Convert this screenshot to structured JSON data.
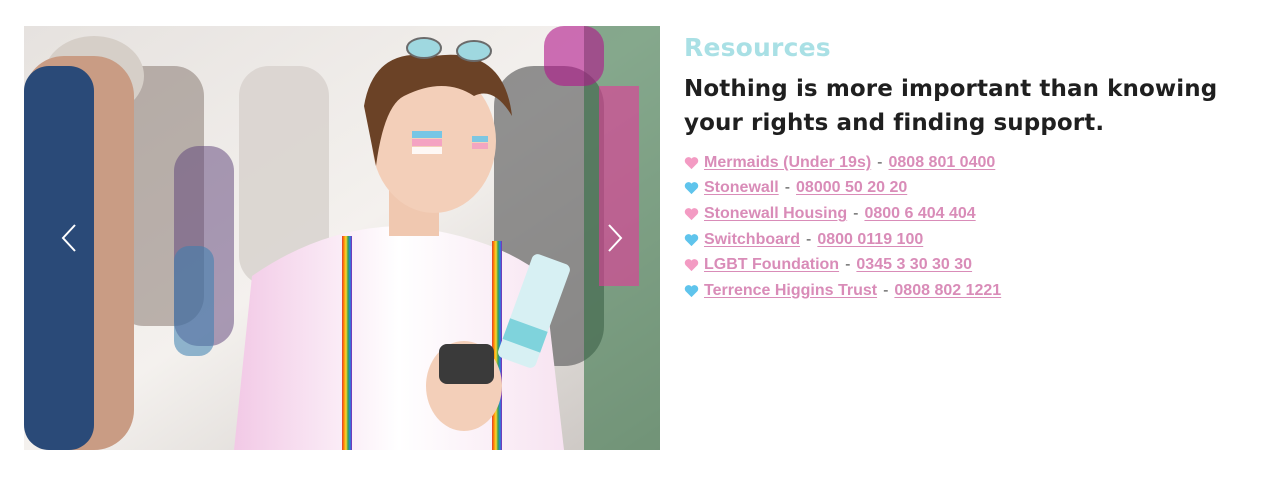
{
  "carousel": {
    "prev_icon": "chevron-left-icon",
    "next_icon": "chevron-right-icon"
  },
  "resources": {
    "section_label": "Resources",
    "headline": "Nothing is more important than knowing your rights and finding support.",
    "separator": "-",
    "items": [
      {
        "name": "Mermaids (Under 19s)",
        "phone": "0808 801 0400",
        "heart": "pink-heart-icon",
        "heart_color": "#f39bc3"
      },
      {
        "name": "Stonewall",
        "phone": "08000 50 20 20",
        "heart": "blue-heart-icon",
        "heart_color": "#5fc4ec"
      },
      {
        "name": "Stonewall Housing",
        "phone": "0800 6 404 404",
        "heart": "pink-heart-icon",
        "heart_color": "#f39bc3"
      },
      {
        "name": "Switchboard",
        "phone": "0800 0119 100",
        "heart": "blue-heart-icon",
        "heart_color": "#5fc4ec"
      },
      {
        "name": "LGBT Foundation",
        "phone": "0345 3 30 30 30",
        "heart": "pink-heart-icon",
        "heart_color": "#f39bc3"
      },
      {
        "name": "Terrence Higgins Trust",
        "phone": "0808 802 1221",
        "heart": "blue-heart-icon",
        "heart_color": "#5fc4ec"
      }
    ]
  },
  "colors": {
    "label_teal": "#a9e0e5",
    "link_pink": "#d98cb8",
    "headline": "#1f1f1f"
  }
}
